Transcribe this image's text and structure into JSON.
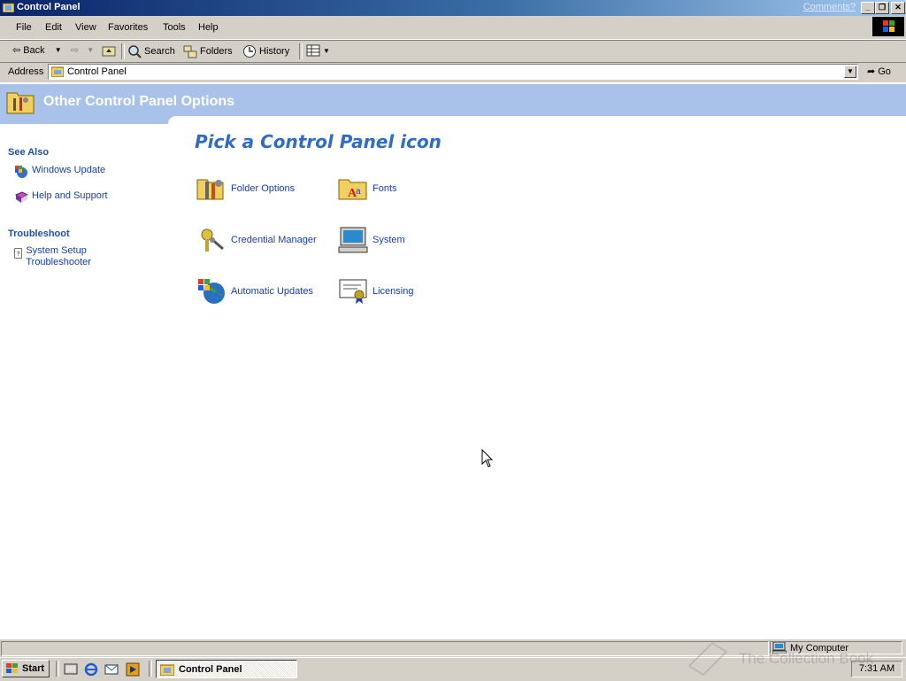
{
  "window": {
    "title": "Control Panel",
    "comments_link": "Comments?",
    "minimize": "_",
    "restore": "❐",
    "close": "✕"
  },
  "menu": [
    "File",
    "Edit",
    "View",
    "Favorites",
    "Tools",
    "Help"
  ],
  "toolbar": {
    "back": "Back",
    "search": "Search",
    "folders": "Folders",
    "history": "History"
  },
  "address": {
    "label": "Address",
    "value": "Control Panel",
    "go": "Go"
  },
  "header": {
    "title": "Other Control Panel Options"
  },
  "sidebar": {
    "see_also": {
      "heading": "See Also",
      "links": [
        "Windows Update",
        "Help and Support"
      ]
    },
    "troubleshoot": {
      "heading": "Troubleshoot",
      "links": [
        "System Setup Troubleshooter"
      ]
    }
  },
  "main": {
    "heading": "Pick a Control Panel icon",
    "items": [
      {
        "label": "Folder Options",
        "icon": "folder-options-icon"
      },
      {
        "label": "Fonts",
        "icon": "fonts-icon"
      },
      {
        "label": "Credential Manager",
        "icon": "credential-manager-icon"
      },
      {
        "label": "System",
        "icon": "system-icon"
      },
      {
        "label": "Automatic Updates",
        "icon": "automatic-updates-icon"
      },
      {
        "label": "Licensing",
        "icon": "licensing-icon"
      }
    ]
  },
  "statusbar": {
    "zone": "My Computer"
  },
  "taskbar": {
    "start": "Start",
    "task": "Control Panel",
    "clock": "7:31 AM"
  },
  "watermark": "The Collection Book",
  "colors": {
    "title_gradient_start": "#0a246a",
    "header_band": "#a9c2ea",
    "link": "#1a3fa0",
    "heading_blue": "#2e6cc8"
  }
}
